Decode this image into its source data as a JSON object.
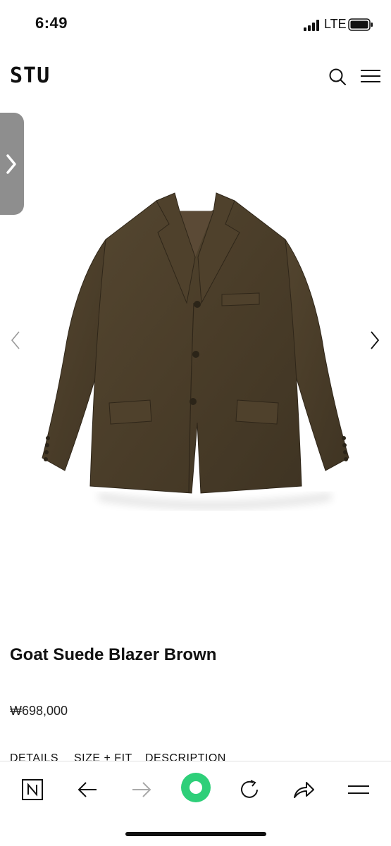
{
  "status_bar": {
    "time": "6:49",
    "network": "LTE"
  },
  "header": {
    "logo": "STU",
    "icons": [
      "search-icon",
      "menu-icon"
    ]
  },
  "carousel": {
    "prev_icon": "chevron-left-icon",
    "next_icon": "chevron-right-icon",
    "side_tab_icon": "chevron-right-icon"
  },
  "product": {
    "title": "Goat Suede Blazer Brown",
    "price": "₩698,000",
    "tabs": [
      "DETAILS",
      "SIZE + FIT",
      "DESCRIPTION"
    ]
  },
  "toolbar": {
    "items": [
      "n-home-icon",
      "back-arrow-icon",
      "forward-arrow-icon",
      "green-dot-icon",
      "refresh-icon",
      "share-icon",
      "menu-icon"
    ]
  },
  "colors": {
    "accent_green": "#2ecf79",
    "blazer_brown": "#4b3f2a",
    "side_tab": "#8e8e8e"
  }
}
